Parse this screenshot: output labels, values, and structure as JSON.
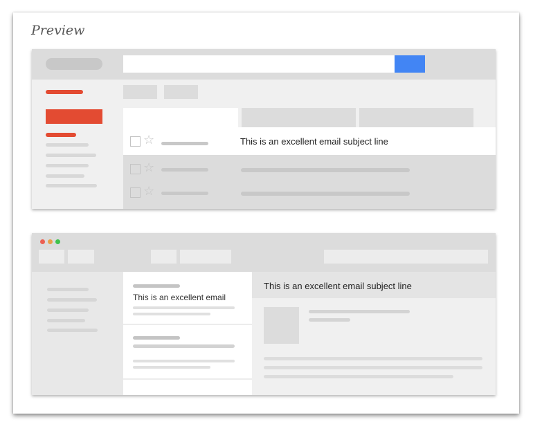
{
  "preview": {
    "title": "Preview"
  },
  "mock_inbox": {
    "highlight_subject": "This is an excellent email subject line",
    "accent_color": "#e34b32",
    "search_button_color": "#4285f4",
    "star_icon": "star-outline-icon"
  },
  "mock_mail_app": {
    "window_controls": [
      "#ec5f52",
      "#e8a04a",
      "#3ec24c"
    ],
    "list_preview_text": "This is an excellent email",
    "reading_subject": "This is an excellent email subject line"
  }
}
